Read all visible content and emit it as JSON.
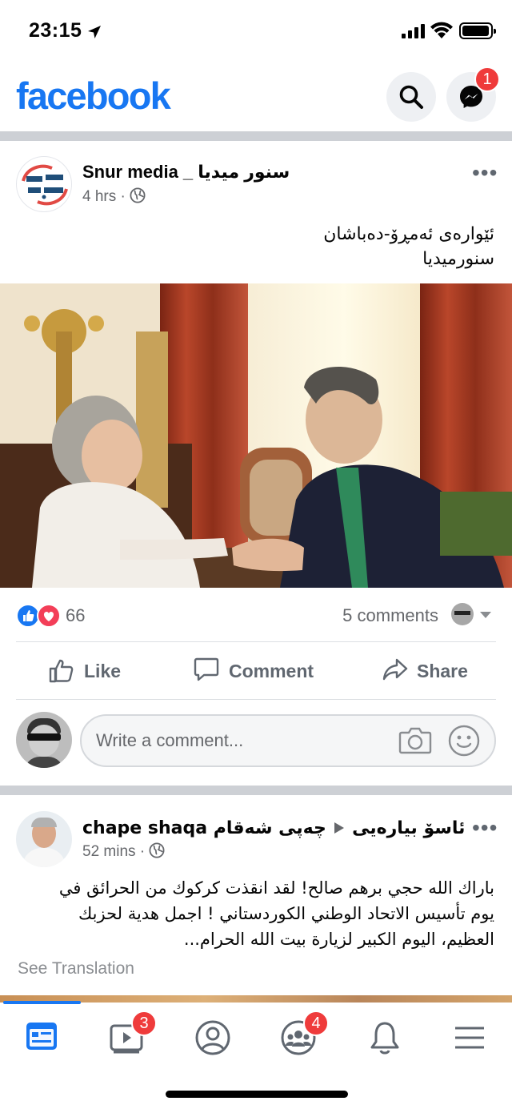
{
  "status": {
    "time": "23:15",
    "icons": [
      "location-arrow-icon",
      "cellular-signal-icon",
      "wifi-icon",
      "battery-icon"
    ]
  },
  "header": {
    "logo": "facebook",
    "messenger_badge": "1"
  },
  "post1": {
    "author": "Snur media _ سنور میدیا",
    "time": "4 hrs",
    "audience_icon": "globe-icon",
    "text_lines": [
      "ئێوارەی ئەمڕۆ-دەباشان",
      "سنورمیدیا"
    ],
    "reaction_count": "66",
    "comments": "5 comments",
    "actions": {
      "like": "Like",
      "comment": "Comment",
      "share": "Share"
    },
    "comment_placeholder": "Write a comment..."
  },
  "post2": {
    "author": "ئاسۆ بیارەیی",
    "page": "چەپی شەقام chape shaqa",
    "time": "52 mins",
    "text_lines": [
      "باراك الله حجي برهم صالح! لقد انقذت كركوك من الحرائق في",
      "يوم تأسيس الاتحاد الوطني الكوردستاني ! اجمل هدية لحزبك",
      "العظيم، اليوم الكبير لزيارة بيت الله الحرام..."
    ],
    "see_translation": "See Translation"
  },
  "tabbar": {
    "watch_badge": "3",
    "groups_badge": "4"
  },
  "colors": {
    "brand": "#1877f2",
    "badge": "#ef3b3b",
    "text_secondary": "#65676b"
  }
}
